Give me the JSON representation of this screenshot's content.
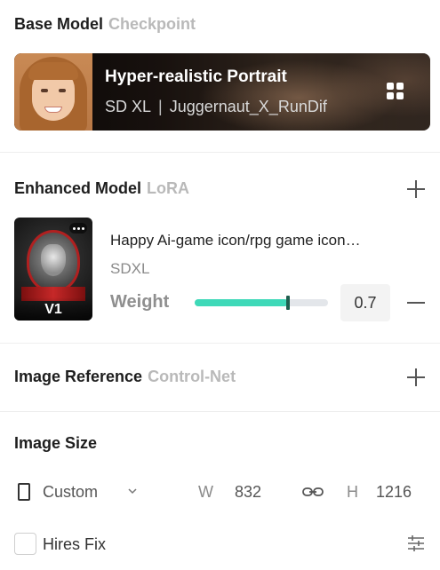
{
  "base_model": {
    "title": "Base Model",
    "subtitle": "Checkpoint",
    "name": "Hyper-realistic Portrait",
    "version": "SD XL",
    "separator": "|",
    "checkpoint": "Juggernaut_X_RunDif"
  },
  "enhanced_model": {
    "title": "Enhanced Model",
    "subtitle": "LoRA",
    "item": {
      "name": "Happy Ai-game icon/rpg game icon…",
      "base": "SDXL",
      "version_badge": "V1",
      "weight_label": "Weight",
      "weight_value": "0.7",
      "weight_fraction": 0.7
    }
  },
  "image_reference": {
    "title": "Image Reference",
    "subtitle": "Control-Net"
  },
  "image_size": {
    "title": "Image Size",
    "preset": "Custom",
    "width_label": "W",
    "width_value": "832",
    "height_label": "H",
    "height_value": "1216"
  },
  "hires_fix": {
    "label": "Hires Fix",
    "checked": false
  },
  "colors": {
    "slider_fill": "#3ed9b8",
    "muted_label": "#b9b9b9"
  }
}
